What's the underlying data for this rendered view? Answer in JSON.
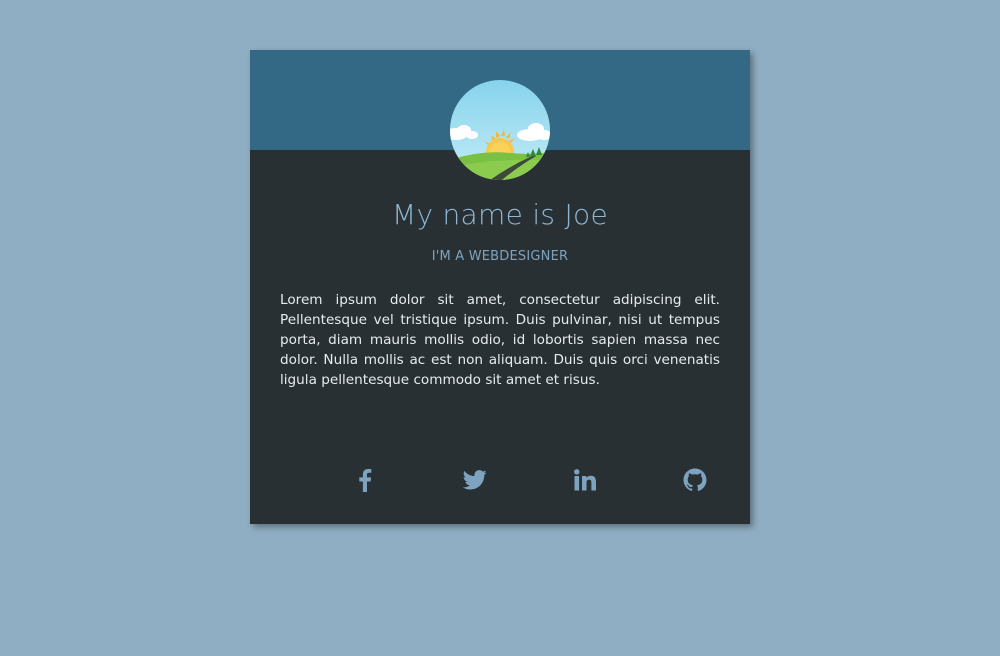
{
  "profile": {
    "name": "My name is Joe",
    "role": "I'M A WEBDESIGNER",
    "bio": "Lorem ipsum dolor sit amet, consectetur adipiscing elit. Pellentesque vel tristique ipsum. Duis pulvinar, nisi ut tempus porta, diam mauris mollis odio, id lobortis sapien massa nec dolor. Nulla mollis ac est non aliquam. Duis quis orci venenatis ligula pellentesque commodo sit amet et risus."
  },
  "social": [
    {
      "icon": "facebook-icon"
    },
    {
      "icon": "twitter-icon"
    },
    {
      "icon": "linkedin-icon"
    },
    {
      "icon": "github-icon"
    }
  ],
  "colors": {
    "page_background": "#8fadc3",
    "card_background": "#293033",
    "header_background": "#336985",
    "name_color": "#8eb7d6",
    "icon_color": "#7ea3c0"
  }
}
